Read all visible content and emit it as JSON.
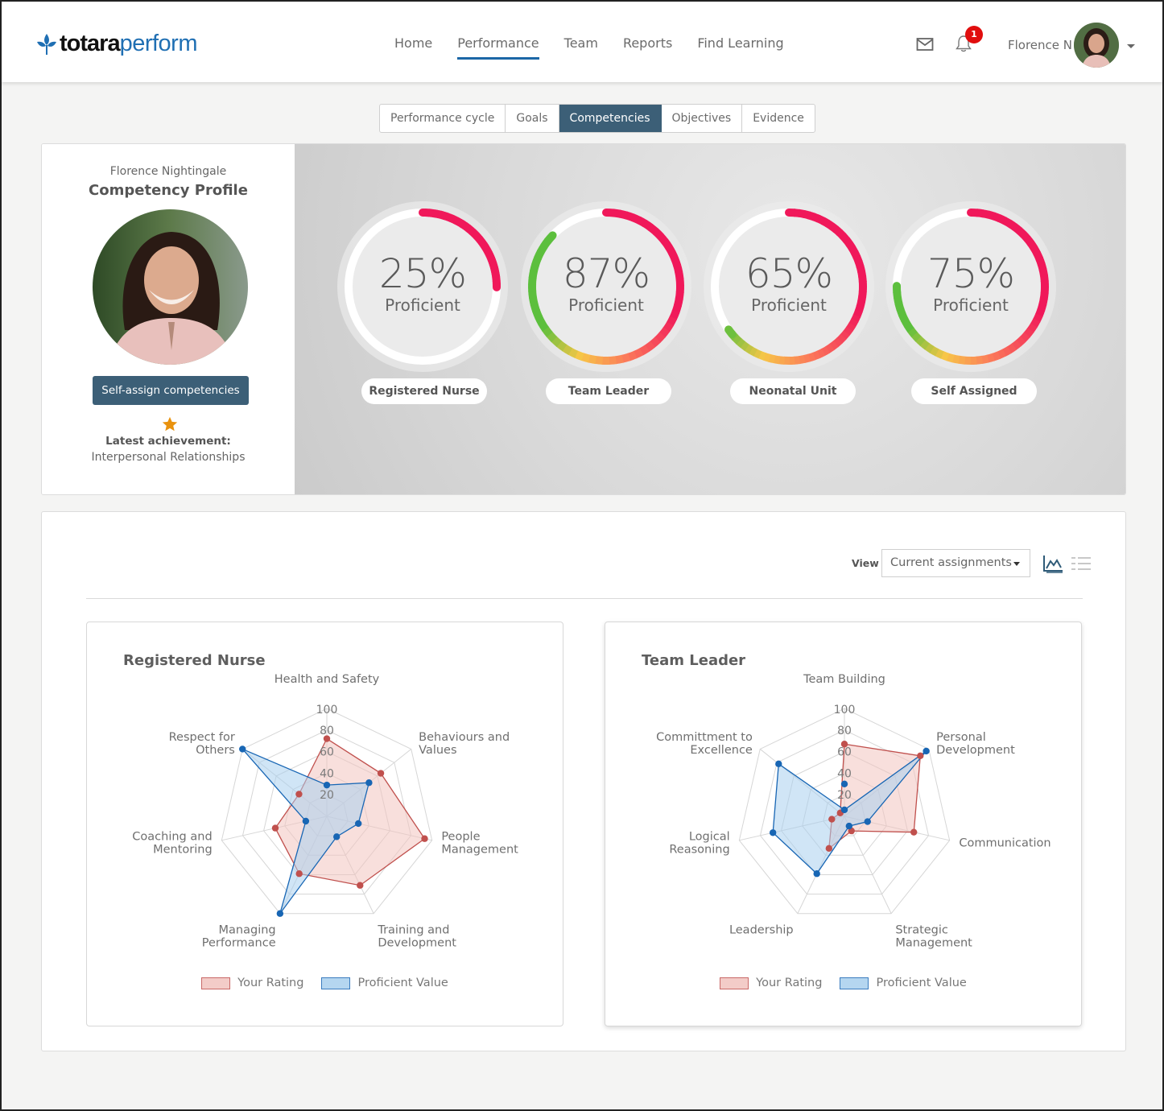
{
  "header": {
    "logo": {
      "bold": "totara",
      "light": "perform"
    },
    "nav": [
      {
        "label": "Home",
        "active": false
      },
      {
        "label": "Performance",
        "active": true
      },
      {
        "label": "Team",
        "active": false
      },
      {
        "label": "Reports",
        "active": false
      },
      {
        "label": "Find Learning",
        "active": false
      }
    ],
    "notifications_count": "1",
    "user_name": "Florence N",
    "icons": [
      "mail-icon",
      "bell-icon",
      "avatar",
      "chevron-down-icon"
    ]
  },
  "tabs": [
    {
      "label": "Performance cycle",
      "active": false
    },
    {
      "label": "Goals",
      "active": false
    },
    {
      "label": "Competencies",
      "active": true
    },
    {
      "label": "Objectives",
      "active": false
    },
    {
      "label": "Evidence",
      "active": false
    }
  ],
  "profile": {
    "name": "Florence Nightingale",
    "title": "Competency Profile",
    "self_assign_label": "Self-assign competencies",
    "achievement_label": "Latest achievement:",
    "achievement_value": "Interpersonal Relationships"
  },
  "gauges": [
    {
      "value": "25%",
      "percent": 25,
      "sub": "Proficient",
      "label": "Registered Nurse"
    },
    {
      "value": "87%",
      "percent": 87,
      "sub": "Proficient",
      "label": "Team Leader"
    },
    {
      "value": "65%",
      "percent": 65,
      "sub": "Proficient",
      "label": "Neonatal Unit"
    },
    {
      "value": "75%",
      "percent": 75,
      "sub": "Proficient",
      "label": "Self Assigned"
    }
  ],
  "gauge_colors": {
    "low": "#f0185a",
    "mid": "#f7c648",
    "high": "#5cbf3d"
  },
  "panel": {
    "view_label": "View",
    "view_selected": "Current assignments",
    "view_icons": [
      "chart-view-icon",
      "list-view-icon"
    ]
  },
  "chart_data": [
    {
      "type": "radar",
      "title": "Registered Nurse",
      "axes": [
        "Health and Safety",
        "Behaviours and Values",
        "People Management",
        "Training and Development",
        "Managing Performance",
        "Coaching and Mentoring",
        "Respect for Others"
      ],
      "axis_label_lines": [
        [
          "Health and Safety"
        ],
        [
          "Behaviours and",
          "Values"
        ],
        [
          "People",
          "Management"
        ],
        [
          "Training and",
          "Development"
        ],
        [
          "Managing",
          "Performance"
        ],
        [
          "Coaching and",
          "Mentoring"
        ],
        [
          "Respect for",
          "Others"
        ]
      ],
      "ticks": [
        20,
        40,
        60,
        80,
        100
      ],
      "range": [
        0,
        100
      ],
      "series": [
        {
          "name": "Your Rating",
          "color": "#c0504d",
          "fill": "#f2c4bf",
          "values": [
            72,
            64,
            93,
            71,
            59,
            49,
            33
          ]
        },
        {
          "name": "Proficient Value",
          "color": "#1866b4",
          "fill": "#a9d0ee",
          "values": [
            29,
            50,
            30,
            21,
            100,
            20,
            100
          ]
        }
      ],
      "legend": [
        "Your Rating",
        "Proficient Value"
      ]
    },
    {
      "type": "radar",
      "title": "Team Leader",
      "axes": [
        "Team Building",
        "Personal Development",
        "Communication",
        "Strategic Management",
        "Leadership",
        "Logical Reasoning",
        "Committment to Excellence"
      ],
      "axis_label_lines": [
        [
          "Team Building"
        ],
        [
          "Personal",
          "Development"
        ],
        [
          "Communication"
        ],
        [
          "Strategic",
          "Management"
        ],
        [
          "Leadership"
        ],
        [
          "Logical",
          "Reasoning"
        ],
        [
          "Committment to",
          "Excellence"
        ]
      ],
      "ticks": [
        20,
        40,
        60,
        80,
        100
      ],
      "range": [
        0,
        100
      ],
      "series": [
        {
          "name": "Your Rating",
          "color": "#c0504d",
          "fill": "#f2c4bf",
          "values": [
            67,
            90,
            66,
            15,
            33,
            12,
            5
          ]
        },
        {
          "name": "Proficient Value",
          "color": "#1866b4",
          "fill": "#a9d0ee",
          "values": [
            6,
            97,
            22,
            10,
            59,
            68,
            78
          ]
        }
      ],
      "extra_point": {
        "series": "Proficient Value",
        "axis": "Team Building",
        "value": 30
      },
      "legend": [
        "Your Rating",
        "Proficient Value"
      ]
    }
  ]
}
